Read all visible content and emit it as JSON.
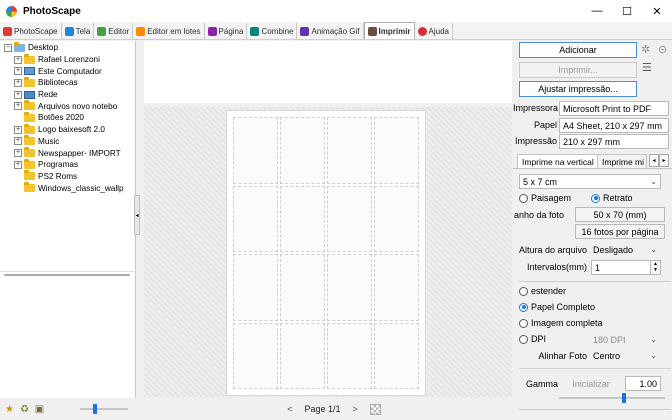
{
  "window": {
    "title": "PhotoScape",
    "min": "—",
    "max": "☐",
    "close": "✕"
  },
  "tabs": [
    {
      "label": "PhotoScape",
      "color": "#e53935"
    },
    {
      "label": "Tela",
      "color": "#1e88e5"
    },
    {
      "label": "Editor",
      "color": "#43a047"
    },
    {
      "label": "Editor em lotes",
      "color": "#fb8c00"
    },
    {
      "label": "Página",
      "color": "#8e24aa"
    },
    {
      "label": "Combine",
      "color": "#00897b"
    },
    {
      "label": "Animação Gif",
      "color": "#5e35b1"
    },
    {
      "label": "Imprimir",
      "color": "#6d4c41"
    },
    {
      "label": "Ajuda",
      "color": "#d32f2f"
    }
  ],
  "tree": {
    "root": "Desktop",
    "items": [
      {
        "label": "Rafael Lorenzoni",
        "expandable": true,
        "icon": "folder"
      },
      {
        "label": "Este Computador",
        "expandable": true,
        "icon": "computer"
      },
      {
        "label": "Bibliotecas",
        "expandable": true,
        "icon": "folder"
      },
      {
        "label": "Rede",
        "expandable": true,
        "icon": "network"
      },
      {
        "label": "Arquivos novo notebo",
        "expandable": true,
        "icon": "folder"
      },
      {
        "label": "Botões 2020",
        "expandable": false,
        "icon": "folder"
      },
      {
        "label": "Logo baixesoft 2.0",
        "expandable": true,
        "icon": "folder"
      },
      {
        "label": "Music",
        "expandable": true,
        "icon": "folder"
      },
      {
        "label": "Newspapper- IMPORT",
        "expandable": true,
        "icon": "folder"
      },
      {
        "label": "Programas",
        "expandable": true,
        "icon": "folder"
      },
      {
        "label": "PS2 Roms",
        "expandable": false,
        "icon": "folder"
      },
      {
        "label": "Windows_classic_wallp",
        "expandable": false,
        "icon": "folder"
      }
    ]
  },
  "left_bottom": {
    "thumb_size_level": 0.3
  },
  "center": {
    "prev": "<",
    "page": "Page 1/1",
    "next": ">"
  },
  "right": {
    "add": "Adicionar",
    "print": "Imprimir...",
    "adjust": "Ajustar impressão...",
    "printer_label": "Impressora",
    "printer_value": "Microsoft Print to PDF",
    "paper_label": "Papel",
    "paper_value": "A4 Sheet, 210 x 297 mm",
    "print_label": "Impressão",
    "print_value": "210 x 297 mm",
    "tab_vertical": "Imprime na vertical",
    "tab_other": "Imprime mi",
    "size_option": "5 x 7 cm",
    "orient_landscape": "Paisagem",
    "orient_portrait": "Retrato",
    "photo_size_label": "anho da foto",
    "photo_size_value": "50 x 70 (mm)",
    "photos_per_page": "16 fotos por página",
    "file_height_label": "Altura do arquivo",
    "file_height_value": "Desligado",
    "interval_label": "Intervalos(mm)",
    "interval_value": "1",
    "opt_stretch": "estender",
    "opt_full_paper": "Papel Completo",
    "opt_full_image": "Imagem completa",
    "opt_dpi": "DPI",
    "dpi_value": "180 DPI",
    "align_label": "Alinhar Foto",
    "align_value": "Centro",
    "gamma_label": "Gamma",
    "gamma_reset": "Inicializar",
    "gamma_value": "1.00",
    "gamma_level": 0.62
  }
}
